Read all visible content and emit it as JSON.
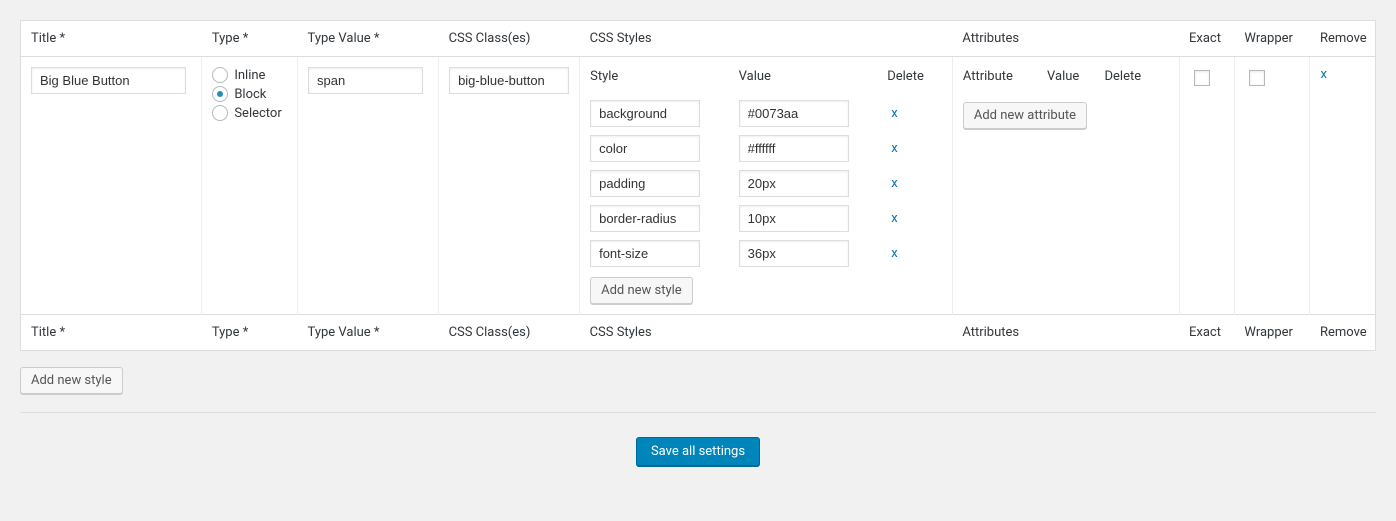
{
  "headers": {
    "title": "Title *",
    "type": "Type *",
    "type_value": "Type Value *",
    "css_classes": "CSS Class(es)",
    "css_styles": "CSS Styles",
    "attributes": "Attributes",
    "exact": "Exact",
    "wrapper": "Wrapper",
    "remove": "Remove"
  },
  "row": {
    "title": "Big Blue Button",
    "type_options": {
      "inline": "Inline",
      "block": "Block",
      "selector": "Selector"
    },
    "type_selected": "block",
    "type_value": "span",
    "css_class": "big-blue-button",
    "remove_x": "x"
  },
  "styles": {
    "header_style": "Style",
    "header_value": "Value",
    "header_delete": "Delete",
    "rows": [
      {
        "name": "background",
        "value": "#0073aa"
      },
      {
        "name": "color",
        "value": "#ffffff"
      },
      {
        "name": "padding",
        "value": "20px"
      },
      {
        "name": "border-radius",
        "value": "10px"
      },
      {
        "name": "font-size",
        "value": "36px"
      }
    ],
    "delete_x": "x",
    "add_label": "Add new style"
  },
  "attrs": {
    "header_attr": "Attribute",
    "header_value": "Value",
    "header_delete": "Delete",
    "add_label": "Add new attribute"
  },
  "buttons": {
    "add_style": "Add new style",
    "save_all": "Save all settings"
  }
}
